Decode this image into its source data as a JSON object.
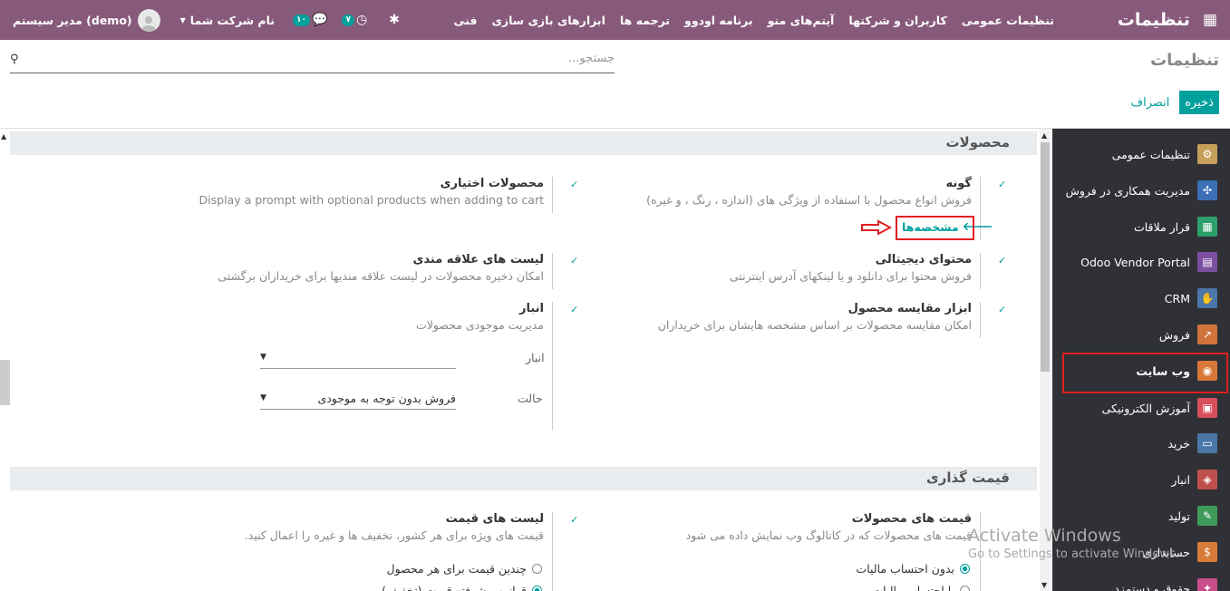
{
  "topbar": {
    "brand": "تنظیمات",
    "menu": [
      "تنظیمات عمومی",
      "کاربران و شرکتها",
      "آیتم‌های منو",
      "برنامه اودوو",
      "ترجمه ها",
      "ابزارهای بازی سازی",
      "فنی"
    ],
    "user": "مدیر سیستم (demo)",
    "company": "نام شرکت شما",
    "messages_count": "۱۰",
    "activities_count": "۷"
  },
  "control_panel": {
    "title": "تنظیمات",
    "search_placeholder": "جستجو...",
    "save_label": "ذخیره",
    "discard_label": "انصراف"
  },
  "sidebar": {
    "items": [
      {
        "label": "تنظیمات عمومی",
        "color": "#c6a05a",
        "icon": "gear-icon"
      },
      {
        "label": "مدیریت همکاری در فروش",
        "color": "#3c6fb6",
        "icon": "partners-icon"
      },
      {
        "label": "قرار ملاقات",
        "color": "#2d9f6b",
        "icon": "calendar-icon"
      },
      {
        "label": "Odoo Vendor Portal",
        "color": "#7b4fa0",
        "icon": "portal-icon"
      },
      {
        "label": "CRM",
        "color": "#4a76a8",
        "icon": "handshake-icon"
      },
      {
        "label": "فروش",
        "color": "#d0743c",
        "icon": "chart-icon"
      },
      {
        "label": "وب سایت",
        "color": "#d9773a",
        "icon": "globe-icon"
      },
      {
        "label": "آموزش الکترونیکی",
        "color": "#d94f5c",
        "icon": "elearning-icon"
      },
      {
        "label": "خرید",
        "color": "#4a76a8",
        "icon": "card-icon"
      },
      {
        "label": "انبار",
        "color": "#c0504d",
        "icon": "box-icon"
      },
      {
        "label": "تولید",
        "color": "#3f9b5a",
        "icon": "wrench-icon"
      },
      {
        "label": "حسابداری",
        "color": "#d97b3a",
        "icon": "invoice-icon"
      },
      {
        "label": "حقوق و دستمزد",
        "color": "#c94f8a",
        "icon": "payroll-icon"
      }
    ]
  },
  "sections": {
    "products": {
      "title": "محصولات",
      "variants": {
        "title": "گونه",
        "desc": "فروش انواع محصول با استفاده از ویژگی های (اندازه ، رنگ ، و غیره)",
        "link": "مشخصه‌ها"
      },
      "optional": {
        "title": "محصولات اختیاری",
        "desc": "Display a prompt with optional products when adding to cart"
      },
      "digital": {
        "title": "محتوای دیجیتالی",
        "desc": "فروش محتوا برای دانلود و یا لینکهای آدرس اینترنتی"
      },
      "wishlist": {
        "title": "لیست های علاقه مندی",
        "desc": "امکان ذخیره محصولات در لیست علاقه مندیها برای خریداران برگشتی"
      },
      "comparison": {
        "title": "ابزار مقایسه محصول",
        "desc": "امکان مقایسه محصولات بر اساس مشخصه هایشان برای خریداران"
      },
      "inventory": {
        "title": "انبار",
        "desc": "مدیریت موجودی محصولات",
        "warehouse_label": "انبار",
        "warehouse_value": "",
        "mode_label": "حالت",
        "mode_value": "فروش بدون توجه به موجودی"
      }
    },
    "pricing": {
      "title": "قیمت گذاری",
      "product_prices": {
        "title": "قیمت های محصولات",
        "desc": "قیمت های محصولات که در کاتالوگ وب نمایش داده می شود",
        "radio1": "بدون احتساب مالیات",
        "radio2": "با احتساب مالیات"
      },
      "pricelists": {
        "title": "لیست های قیمت",
        "desc": "قیمت های ویژه برای هر کشور، تخفیف ها و غیره را اعمال کنید.",
        "radio1": "چندین قیمت برای هر محصول",
        "radio2": "قوانین پیشرفته قیمت (تخفیف)"
      }
    }
  },
  "watermark": {
    "line1": "Activate Windows",
    "line2": "Go to Settings to activate Windows."
  }
}
